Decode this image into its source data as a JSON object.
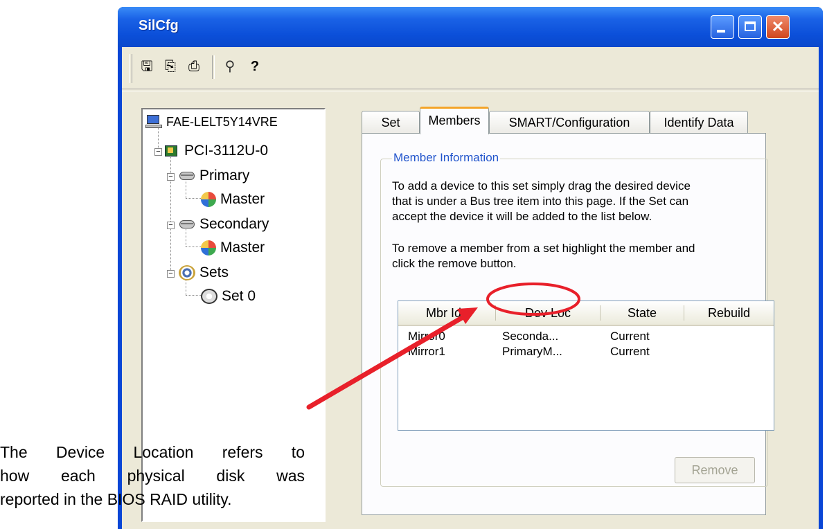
{
  "window": {
    "title": "SilCfg"
  },
  "toolbar": {
    "tools": [
      {
        "icon": "save-icon",
        "glyph": "🖫"
      },
      {
        "icon": "copy-icon",
        "glyph": "⎘"
      },
      {
        "icon": "print-icon",
        "glyph": "⎙"
      },
      {
        "icon": "find-icon",
        "glyph": "⚲"
      },
      {
        "icon": "help-icon",
        "glyph": "?"
      }
    ]
  },
  "tree": {
    "items": [
      {
        "label": "FAE-LELT5Y14VRE",
        "icon": "computer-icon"
      },
      {
        "label": "PCI-3112U-0",
        "icon": "controller-card-icon"
      },
      {
        "label": "Primary",
        "icon": "bus-icon"
      },
      {
        "label": "Master",
        "icon": "disk-device-icon"
      },
      {
        "label": "Secondary",
        "icon": "bus-icon"
      },
      {
        "label": "Master",
        "icon": "disk-device-icon"
      },
      {
        "label": "Sets",
        "icon": "sets-icon"
      },
      {
        "label": "Set 0",
        "icon": "set-icon"
      }
    ]
  },
  "tabs": [
    "Set",
    "Members",
    "SMART/Configuration",
    "Identify Data"
  ],
  "active_tab": "Members",
  "member_info": {
    "title": "Member Information",
    "para1": [
      "To add a device to this set simply drag the desired device",
      "that is under a Bus tree item into this page.  If the Set can",
      "accept the device it will be added to the list below."
    ],
    "para2": [
      "To remove a member from a set highlight the member and",
      "click the remove button."
    ]
  },
  "listview": {
    "columns": [
      "Mbr Idx",
      "Dev Loc",
      "State",
      "Rebuild"
    ],
    "rows": [
      [
        "Mirror0",
        "Seconda...",
        "Current",
        ""
      ],
      [
        "Mirror1",
        "PrimaryM...",
        "Current",
        ""
      ]
    ]
  },
  "remove_button": "Remove",
  "annotation": {
    "lines": [
      "The Device Location refers to",
      "how each physical disk was",
      "reported in the BIOS RAID utility."
    ],
    "arrow_color": "#e8202a"
  }
}
